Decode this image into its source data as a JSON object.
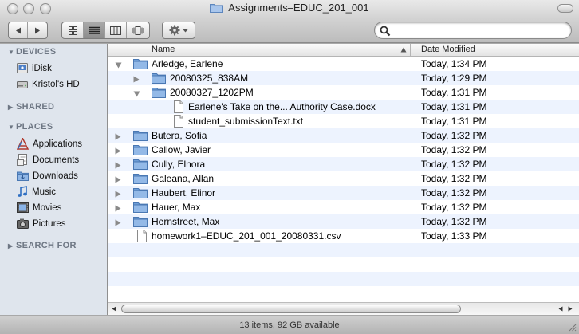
{
  "window": {
    "title": "Assignments–EDUC_201_001"
  },
  "toolbar": {
    "back_icon": "back-arrow-icon",
    "forward_icon": "forward-arrow-icon",
    "view_modes": [
      "icon-view",
      "list-view",
      "column-view",
      "coverflow-view"
    ],
    "active_view": "list-view",
    "action_icon": "gear-icon",
    "search": {
      "value": "",
      "placeholder": ""
    }
  },
  "sidebar": {
    "sections": [
      {
        "title": "DEVICES",
        "expanded": true,
        "items": [
          {
            "label": "iDisk",
            "icon": "idisk-icon"
          },
          {
            "label": "Kristol's HD",
            "icon": "harddrive-icon"
          }
        ]
      },
      {
        "title": "SHARED",
        "expanded": false,
        "items": []
      },
      {
        "title": "PLACES",
        "expanded": true,
        "items": [
          {
            "label": "Applications",
            "icon": "applications-icon"
          },
          {
            "label": "Documents",
            "icon": "documents-icon"
          },
          {
            "label": "Downloads",
            "icon": "downloads-icon"
          },
          {
            "label": "Music",
            "icon": "music-icon"
          },
          {
            "label": "Movies",
            "icon": "movies-icon"
          },
          {
            "label": "Pictures",
            "icon": "pictures-icon"
          }
        ]
      },
      {
        "title": "SEARCH FOR",
        "expanded": false,
        "items": []
      }
    ]
  },
  "columns": {
    "name": "Name",
    "date": "Date Modified"
  },
  "rows": [
    {
      "name": "Arledge, Earlene",
      "date": "Today, 1:34 PM",
      "type": "folder",
      "depth": 0,
      "expanded": true
    },
    {
      "name": "20080325_838AM",
      "date": "Today, 1:29 PM",
      "type": "folder",
      "depth": 1,
      "expanded": false
    },
    {
      "name": "20080327_1202PM",
      "date": "Today, 1:31 PM",
      "type": "folder",
      "depth": 1,
      "expanded": true
    },
    {
      "name": "Earlene's Take on the... Authority Case.docx",
      "date": "Today, 1:31 PM",
      "type": "file",
      "depth": 2
    },
    {
      "name": "student_submissionText.txt",
      "date": "Today, 1:31 PM",
      "type": "file",
      "depth": 2
    },
    {
      "name": "Butera, Sofia",
      "date": "Today, 1:32 PM",
      "type": "folder",
      "depth": 0,
      "expanded": false
    },
    {
      "name": "Callow, Javier",
      "date": "Today, 1:32 PM",
      "type": "folder",
      "depth": 0,
      "expanded": false
    },
    {
      "name": "Cully, Elnora",
      "date": "Today, 1:32 PM",
      "type": "folder",
      "depth": 0,
      "expanded": false
    },
    {
      "name": "Galeana, Allan",
      "date": "Today, 1:32 PM",
      "type": "folder",
      "depth": 0,
      "expanded": false
    },
    {
      "name": "Haubert, Elinor",
      "date": "Today, 1:32 PM",
      "type": "folder",
      "depth": 0,
      "expanded": false
    },
    {
      "name": "Hauer, Max",
      "date": "Today, 1:32 PM",
      "type": "folder",
      "depth": 0,
      "expanded": false
    },
    {
      "name": "Hernstreet, Max",
      "date": "Today, 1:32 PM",
      "type": "folder",
      "depth": 0,
      "expanded": false
    },
    {
      "name": "homework1–EDUC_201_001_20080331.csv",
      "date": "Today, 1:33 PM",
      "type": "file",
      "depth": 0
    }
  ],
  "status": {
    "text": "13 items, 92 GB available"
  },
  "colors": {
    "sidebar_bg": "#dfe5ed",
    "row_alt": "#edf3fe",
    "folder_blue": "#6f9ed6",
    "section_header": "#6e7784"
  }
}
